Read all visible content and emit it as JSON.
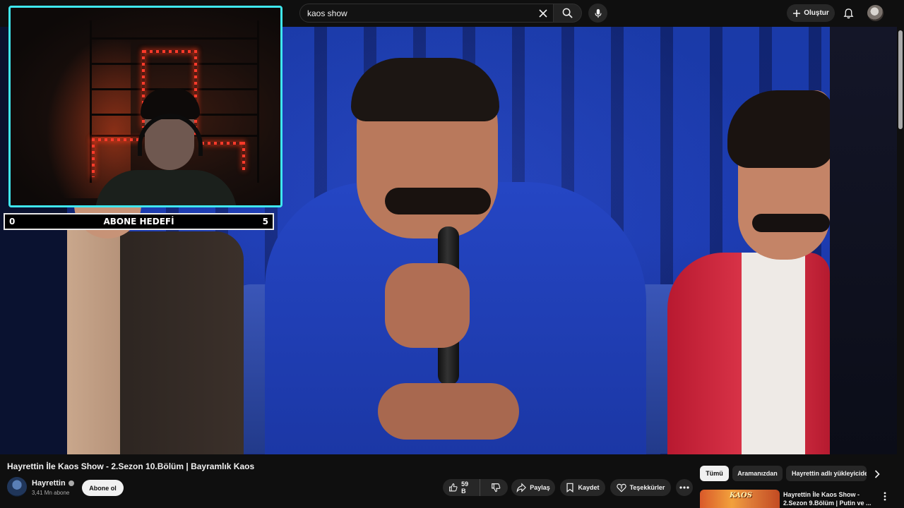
{
  "header": {
    "search_value": "kaos show",
    "create_label": "Oluştur",
    "icons": {
      "clear": "close-icon",
      "search": "search-icon",
      "mic": "microphone-icon",
      "create": "plus-icon",
      "notifications": "bell-icon"
    }
  },
  "overlay": {
    "subgoal": {
      "start": "0",
      "title": "ABONE HEDEFİ",
      "target": "5"
    },
    "webcam_border_color": "#3fe7ef"
  },
  "video": {
    "title": "Hayrettin İle Kaos Show - 2.Sezon 10.Bölüm | Bayramlık Kaos"
  },
  "channel": {
    "name": "Hayrettin",
    "subscribers": "3,41 Mn abone",
    "subscribe_label": "Abone ol"
  },
  "actions": {
    "likes": "59 B",
    "share": "Paylaş",
    "save": "Kaydet",
    "thanks": "Teşekkürler"
  },
  "chips": [
    "Tümü",
    "Aramanızdan",
    "Hayrettin adlı yükleyiciden"
  ],
  "recommendation": {
    "title": "Hayrettin İle Kaos Show - 2.Sezon 9.Bölüm | Putin ve ...",
    "thumb_label": "KAOS"
  },
  "colors": {
    "background": "#0f0f0f",
    "pill": "#272727",
    "accent_webcam": "#3fe7ef"
  }
}
